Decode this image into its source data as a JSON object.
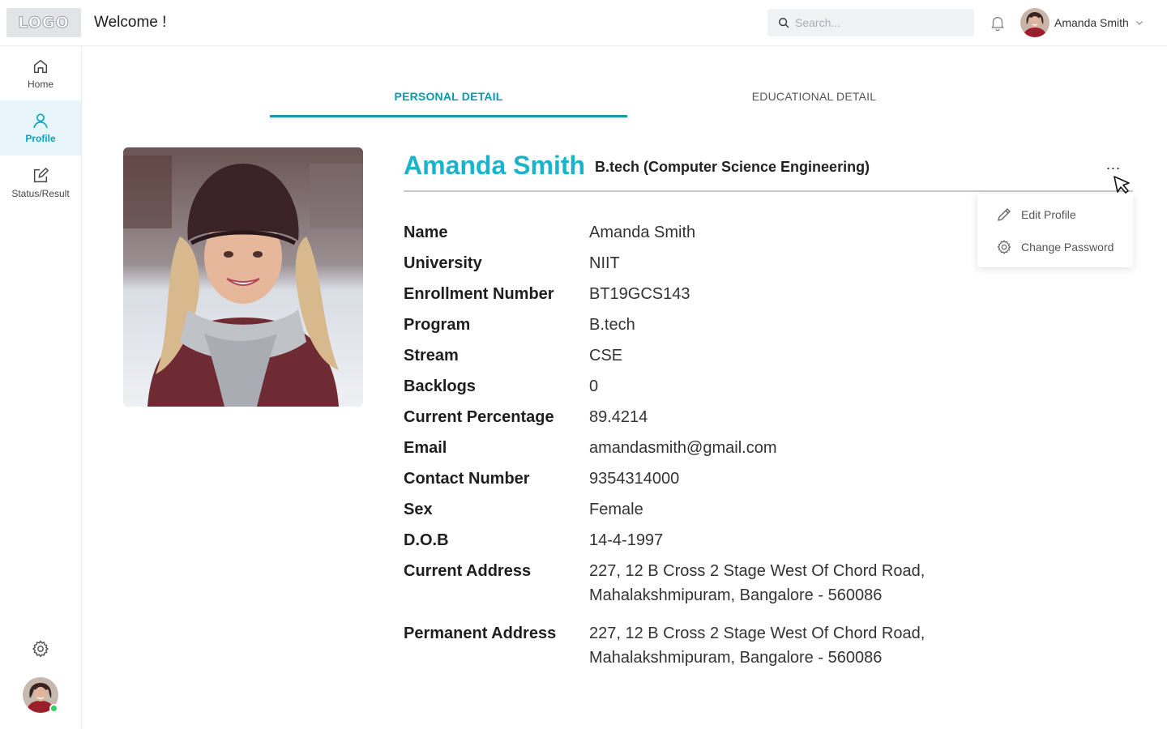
{
  "header": {
    "logo_text": "LOGO",
    "welcome": "Welcome !",
    "search_placeholder": "Search...",
    "user_name": "Amanda Smith"
  },
  "sidebar": {
    "items": [
      {
        "label": "Home",
        "icon": "home-icon"
      },
      {
        "label": "Profile",
        "icon": "user-icon",
        "active": true
      },
      {
        "label": "Status/Result",
        "icon": "edit-icon"
      }
    ]
  },
  "tabs": [
    {
      "label": "PERSONAL DETAIL",
      "active": true
    },
    {
      "label": "EDUCATIONAL DETAIL",
      "active": false
    }
  ],
  "profile": {
    "name": "Amanda Smith",
    "degree": "B.tech (Computer Science Engineering)",
    "more_label": "...",
    "details": [
      {
        "label": "Name",
        "value": "Amanda Smith"
      },
      {
        "label": "University",
        "value": "NIIT"
      },
      {
        "label": "Enrollment Number",
        "value": "BT19GCS143"
      },
      {
        "label": "Program",
        "value": "B.tech"
      },
      {
        "label": "Stream",
        "value": "CSE"
      },
      {
        "label": "Backlogs",
        "value": "0"
      },
      {
        "label": "Current Percentage",
        "value": "89.4214"
      },
      {
        "label": "Email",
        "value": "amandasmith@gmail.com"
      },
      {
        "label": "Contact Number",
        "value": "9354314000"
      },
      {
        "label": "Sex",
        "value": "Female"
      },
      {
        "label": "D.O.B",
        "value": "14-4-1997"
      },
      {
        "label": "Current Address",
        "value_lines": [
          "227, 12 B Cross 2 Stage West Of Chord Road,",
          "Mahalakshmipuram, Bangalore - 560086"
        ]
      },
      {
        "label": "Permanent Address",
        "value_lines": [
          "227, 12 B Cross 2 Stage West Of Chord Road,",
          "Mahalakshmipuram, Bangalore - 560086"
        ]
      }
    ]
  },
  "dropdown": {
    "items": [
      {
        "label": "Edit Profile",
        "icon": "pencil-icon"
      },
      {
        "label": "Change Password",
        "icon": "gear-icon"
      }
    ]
  },
  "colors": {
    "accent": "#1ab3cb",
    "tab_underline": "#1797a8",
    "active_nav_bg": "#e8f6fb",
    "online": "#2fd05a"
  }
}
